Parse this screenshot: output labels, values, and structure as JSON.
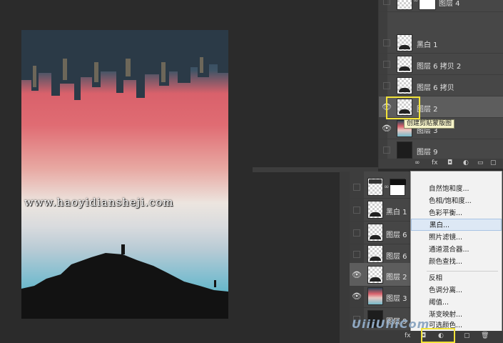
{
  "canvas": {
    "watermark": "www.haoyidiansheji.com"
  },
  "layers_top": {
    "rows": [
      {
        "name": "图层 4",
        "thumb": "topcity",
        "has_mask": true,
        "eye": false
      },
      {
        "name": "黑白 1",
        "thumb": "mtn",
        "has_mask": false,
        "eye": false
      },
      {
        "name": "图层 6 拷贝 2",
        "thumb": "mtn",
        "has_mask": false,
        "eye": false
      },
      {
        "name": "图层 6 拷贝",
        "thumb": "mtn",
        "has_mask": false,
        "eye": false
      },
      {
        "name": "图层 2",
        "thumb": "mtn",
        "has_mask": false,
        "eye": true,
        "selected": true
      },
      {
        "name": "图层 3",
        "thumb": "photo",
        "has_mask": false,
        "eye": true
      },
      {
        "name": "图层 9",
        "thumb": "dark",
        "has_mask": false,
        "eye": false
      }
    ],
    "tooltip": "创建剪贴蒙版图"
  },
  "layers_bottom": {
    "rows": [
      {
        "name": "",
        "thumb": "topcity"
      },
      {
        "name": "黑白 1",
        "thumb": "mtn"
      },
      {
        "name": "图层 6",
        "thumb": "mtn"
      },
      {
        "name": "图层 6",
        "thumb": "mtn"
      },
      {
        "name": "图层 2",
        "thumb": "mtn",
        "eye": true,
        "selected": true
      },
      {
        "name": "图层 3",
        "thumb": "photo",
        "eye": true
      },
      {
        "name": "图层 9",
        "thumb": "dark"
      }
    ]
  },
  "adjustment_menu": {
    "items": [
      {
        "label": "自然饱和度..."
      },
      {
        "label": "色相/饱和度..."
      },
      {
        "label": "色彩平衡..."
      },
      {
        "label": "黑白...",
        "hover": true
      },
      {
        "label": "照片滤镜..."
      },
      {
        "label": "通道混合器..."
      },
      {
        "label": "颜色查找..."
      },
      {
        "label": "反相"
      },
      {
        "label": "色调分离..."
      },
      {
        "label": "阈值..."
      },
      {
        "label": "渐变映射..."
      },
      {
        "label": "可选颜色..."
      }
    ]
  },
  "footer": {
    "fx": "fx"
  },
  "brand": "UiiiUiiiCom",
  "colors": {
    "highlight": "#f2e33a",
    "panel_bg": "#474747",
    "menu_hover": "#dde8f5"
  }
}
